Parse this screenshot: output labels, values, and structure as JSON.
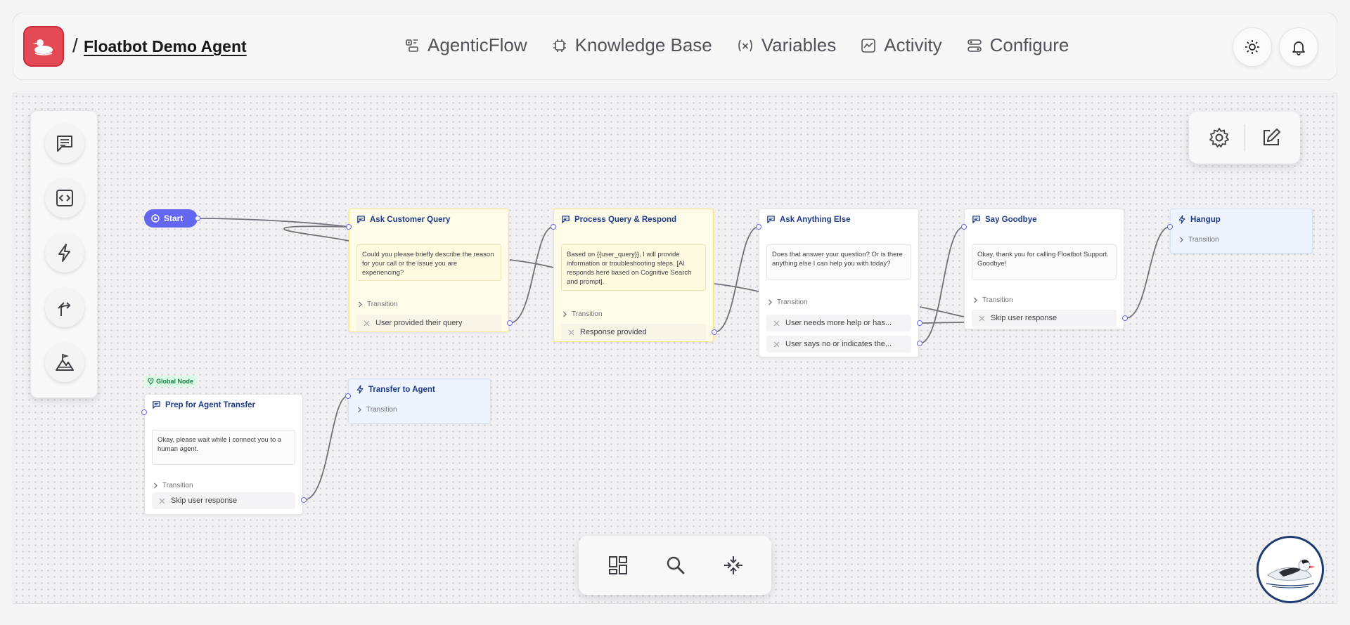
{
  "header": {
    "breadcrumb_separator": "/",
    "agent_name": "Floatbot Demo Agent",
    "nav": [
      {
        "label": "AgenticFlow",
        "icon": "agentic-flow-icon"
      },
      {
        "label": "Knowledge Base",
        "icon": "chip-icon"
      },
      {
        "label": "Variables",
        "icon": "variable-icon"
      },
      {
        "label": "Activity",
        "icon": "activity-icon"
      },
      {
        "label": "Configure",
        "icon": "configure-icon"
      }
    ]
  },
  "canvas": {
    "start_label": "Start",
    "global_badge": "Global Node",
    "nodes": {
      "ask_customer_query": {
        "title": "Ask Customer Query",
        "message": "Could you please briefly describe the reason for your call or the issue you are experiencing?",
        "transition": "Transition",
        "routes": [
          "User provided their query"
        ]
      },
      "process_query": {
        "title": "Process Query & Respond",
        "message": "Based on {{user_query}}, I will provide information or troubleshooting steps. [AI responds here based on Cognitive Search and prompt].",
        "transition": "Transition",
        "routes": [
          "Response provided"
        ]
      },
      "ask_anything_else": {
        "title": "Ask Anything Else",
        "message": "Does that answer your question? Or is there anything else I can help you with today?",
        "transition": "Transition",
        "routes": [
          "User needs more help or has...",
          "User says no or indicates the..."
        ]
      },
      "say_goodbye": {
        "title": "Say Goodbye",
        "message": "Okay, thank you for calling Floatbot Support. Goodbye!",
        "transition": "Transition",
        "routes": [
          "Skip user response"
        ]
      },
      "hangup": {
        "title": "Hangup",
        "transition": "Transition"
      },
      "prep_transfer": {
        "title": "Prep for Agent Transfer",
        "message": "Okay, please wait while I connect you to a human agent.",
        "transition": "Transition",
        "routes": [
          "Skip user response"
        ]
      },
      "transfer_agent": {
        "title": "Transfer to Agent",
        "transition": "Transition"
      }
    }
  },
  "colors": {
    "accent": "#6366f1",
    "node_title": "#1e3a8a",
    "logo_bg": "#e34a55",
    "global_badge_bg": "#dcfce7"
  }
}
